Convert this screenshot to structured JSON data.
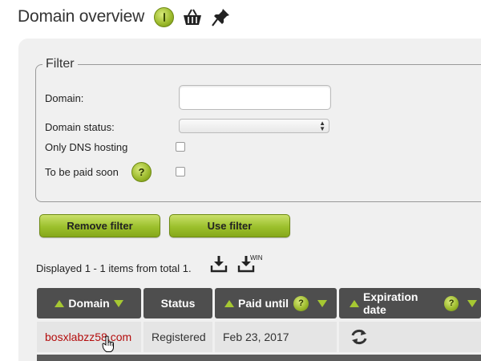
{
  "header": {
    "title": "Domain overview",
    "icons": [
      "info-icon",
      "basket-icon",
      "pin-icon"
    ]
  },
  "filter": {
    "legend": "Filter",
    "domain_label": "Domain:",
    "domain_value": "",
    "status_label": "Domain status:",
    "status_value": "",
    "dns_label": "Only DNS hosting",
    "dns_checked": false,
    "paid_label": "To be paid soon",
    "paid_checked": false,
    "help_glyph": "?"
  },
  "actions": {
    "remove_filter": "Remove filter",
    "use_filter": "Use filter"
  },
  "results": {
    "displayed_text": "Displayed 1 - 1 items from total 1.",
    "win_label": "WIN"
  },
  "table": {
    "columns": [
      "Domain",
      "Status",
      "Paid until",
      "Expiration date"
    ],
    "help_glyph": "?",
    "rows": [
      {
        "domain": "bosxlabzz58.com",
        "status": "Registered",
        "paid_until": "Feb 23, 2017",
        "expiration_icon": "renew-icon"
      }
    ]
  },
  "colors": {
    "accent_green": "#9cc02c",
    "header_dark": "#4e4e4e",
    "link_red": "#b40d0d"
  }
}
